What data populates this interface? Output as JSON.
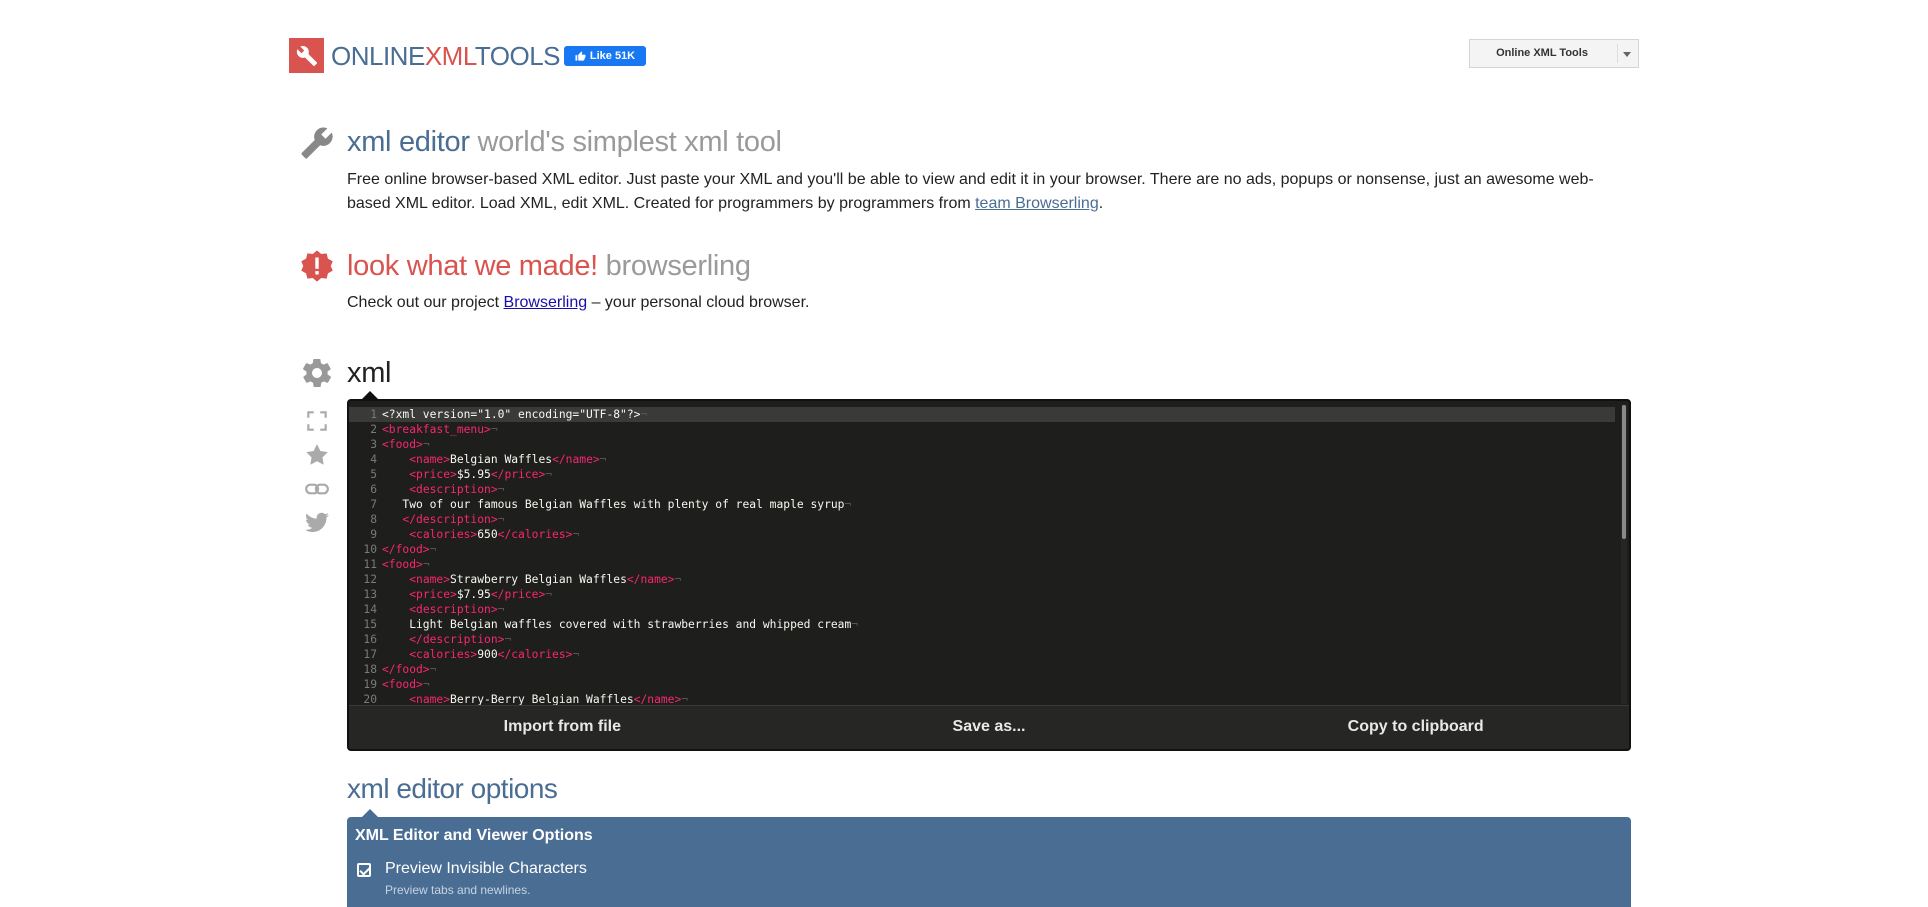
{
  "header": {
    "logo_parts": [
      "ONLINE",
      "XML",
      "TOOLS"
    ],
    "fb_like": "Like 51K",
    "tools_menu": "Online XML Tools"
  },
  "intro": {
    "title": "xml editor",
    "subtitle": "world's simplest xml tool",
    "desc_before": "Free online browser-based XML editor. Just paste your XML and you'll be able to view and edit it in your browser. There are no ads, popups or nonsense, just an awesome web-based XML editor. Load XML, edit XML. Created for programmers by programmers from ",
    "desc_link": "team Browserling",
    "desc_after": "."
  },
  "promo": {
    "title": "look what we made!",
    "subtitle": "browserling",
    "desc_before": "Check out our project ",
    "desc_link": "Browserling",
    "desc_after": " – your personal cloud browser."
  },
  "xml_section": {
    "title": "xml",
    "side_icons": [
      "fullscreen-icon",
      "star-icon",
      "link-icon",
      "twitter-icon"
    ]
  },
  "editor": {
    "lines": [
      "<?xml version=\"1.0\" encoding=\"UTF-8\"?>",
      "<breakfast_menu>",
      "<food>",
      "    <name>Belgian Waffles</name>",
      "    <price>$5.95</price>",
      "    <description>",
      "   Two of our famous Belgian Waffles with plenty of real maple syrup",
      "   </description>",
      "    <calories>650</calories>",
      "</food>",
      "<food>",
      "    <name>Strawberry Belgian Waffles</name>",
      "    <price>$7.95</price>",
      "    <description>",
      "    Light Belgian waffles covered with strawberries and whipped cream",
      "    </description>",
      "    <calories>900</calories>",
      "</food>",
      "<food>",
      "    <name>Berry-Berry Belgian Waffles</name>"
    ],
    "actions": [
      "Import from file",
      "Save as...",
      "Copy to clipboard"
    ]
  },
  "options": {
    "title": "xml editor options",
    "panel_title": "XML Editor and Viewer Options",
    "check_label": "Preview Invisible Characters",
    "check_sub": "Preview tabs and newlines.",
    "checked": true
  },
  "colors": {
    "brand_blue": "#4a6d94",
    "brand_red": "#d9534f",
    "editor_bg": "#1e1e1c",
    "tag_pink": "#f92672"
  }
}
